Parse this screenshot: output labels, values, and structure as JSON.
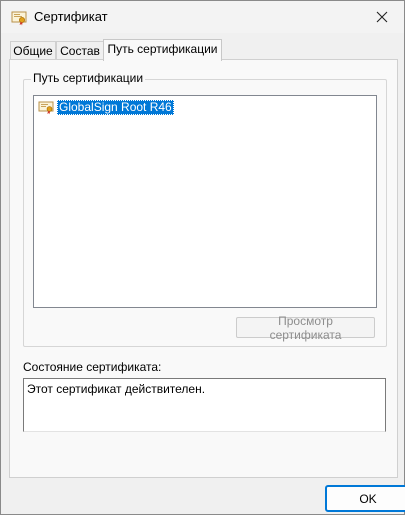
{
  "window": {
    "title": "Сертификат"
  },
  "tabs": [
    {
      "label": "Общие"
    },
    {
      "label": "Состав"
    },
    {
      "label": "Путь сертификации"
    }
  ],
  "path_group": {
    "label": "Путь сертификации",
    "items": [
      {
        "label": "GlobalSign Root R46",
        "icon": "certificate-icon",
        "selected": true
      }
    ],
    "view_button": "Просмотр сертификата"
  },
  "status": {
    "label": "Состояние сертификата:",
    "text": "Этот сертификат действителен."
  },
  "buttons": {
    "ok": "OK"
  },
  "colors": {
    "accent": "#0078d7"
  }
}
